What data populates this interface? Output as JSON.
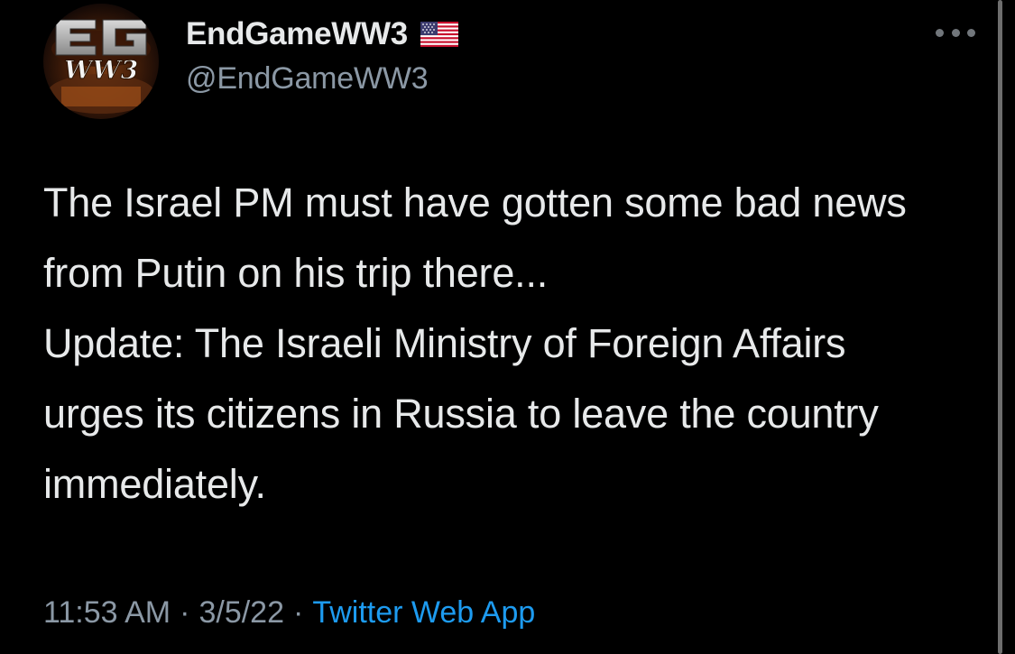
{
  "author": {
    "display_name": "EndGameWW3",
    "handle": "@EndGameWW3",
    "flag_icon": "us-flag-icon",
    "avatar_text": "EG WW3"
  },
  "tweet": {
    "paragraphs": [
      "The Israel PM must have gotten some bad news from Putin on his trip there...",
      "Update: The Israeli Ministry of Foreign Affairs urges its citizens in Russia to leave the country immediately."
    ]
  },
  "meta": {
    "time": "11:53 AM",
    "separator": "·",
    "date": "3/5/22",
    "source": "Twitter Web App"
  },
  "colors": {
    "background": "#000000",
    "text": "#e7e9ea",
    "secondary": "#8b98a5",
    "accent": "#1d9bf0"
  },
  "icons": {
    "more": "more-horizontal-icon"
  }
}
